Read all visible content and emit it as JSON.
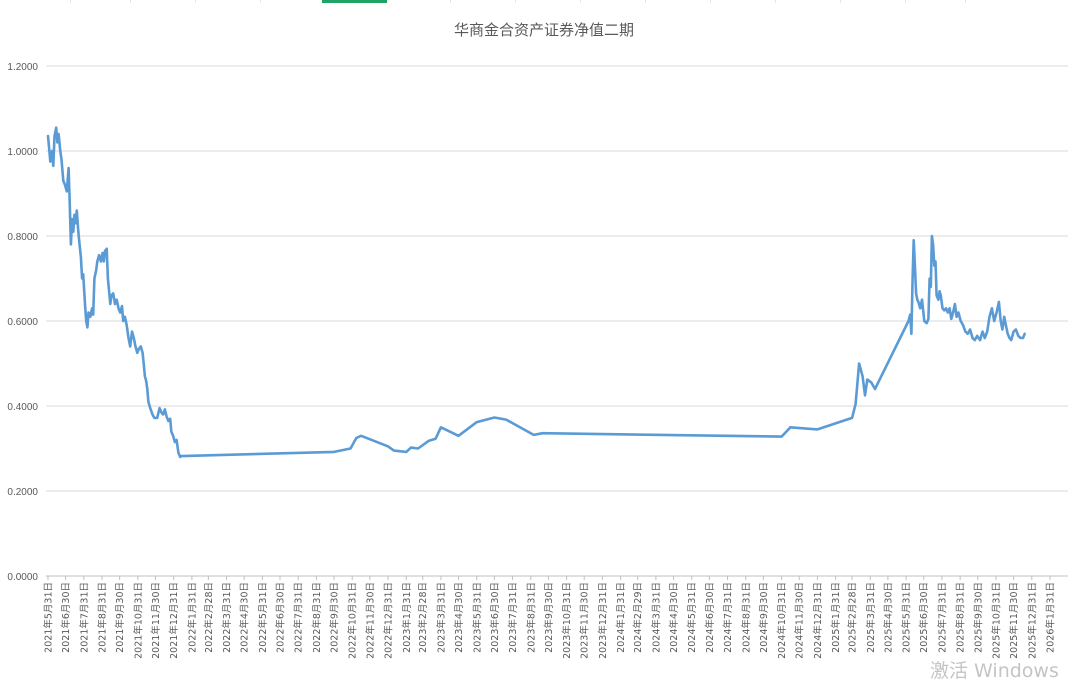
{
  "sheet_tabs": {
    "active_index": 4
  },
  "watermark": "激活 Windows",
  "colors": {
    "line": "#5b9bd5",
    "grid": "#d9d9d9",
    "title": "#595959",
    "tick": "#595959",
    "active_tab": "#21a366"
  },
  "chart_data": {
    "type": "line",
    "title": "华商金合资产证券净值二期",
    "xlabel": "",
    "ylabel": "",
    "ylim": [
      0,
      1.2
    ],
    "y_ticks": [
      "0.0000",
      "0.2000",
      "0.4000",
      "0.6000",
      "0.8000",
      "1.0000",
      "1.2000"
    ],
    "grid": "horizontal",
    "legend": "none",
    "x_ticks": [
      "2021年5月31日",
      "2021年6月30日",
      "2021年7月31日",
      "2021年8月31日",
      "2021年9月30日",
      "2021年10月31日",
      "2021年11月30日",
      "2021年12月31日",
      "2022年1月31日",
      "2022年2月28日",
      "2022年3月31日",
      "2022年4月30日",
      "2022年5月31日",
      "2022年6月30日",
      "2022年7月31日",
      "2022年8月31日",
      "2022年9月30日",
      "2022年10月31日",
      "2022年11月30日",
      "2022年12月31日",
      "2023年1月31日",
      "2023年2月28日",
      "2023年3月31日",
      "2023年4月30日",
      "2023年5月31日",
      "2023年6月30日",
      "2023年7月31日",
      "2023年8月31日",
      "2023年9月30日",
      "2023年10月31日",
      "2023年11月30日",
      "2023年12月31日",
      "2024年1月31日",
      "2024年2月29日",
      "2024年3月31日",
      "2024年4月30日",
      "2024年5月31日",
      "2024年6月30日",
      "2024年7月31日",
      "2024年8月31日",
      "2024年9月30日",
      "2024年10月31日",
      "2024年11月30日",
      "2024年12月31日",
      "2025年1月31日",
      "2025年2月28日",
      "2025年3月31日",
      "2025年4月30日",
      "2025年5月31日",
      "2025年6月30日",
      "2025年7月31日",
      "2025年8月31日",
      "2025年9月30日",
      "2025年10月31日",
      "2025年11月30日",
      "2025年12月31日",
      "2026年1月31日"
    ],
    "series": [
      {
        "values": [
          [
            "2021-05-31",
            1.035
          ],
          [
            "2021-06-02",
            1.005
          ],
          [
            "2021-06-04",
            0.975
          ],
          [
            "2021-06-07",
            1.0
          ],
          [
            "2021-06-09",
            0.965
          ],
          [
            "2021-06-11",
            1.035
          ],
          [
            "2021-06-14",
            1.055
          ],
          [
            "2021-06-16",
            1.02
          ],
          [
            "2021-06-18",
            1.04
          ],
          [
            "2021-06-21",
            1.0
          ],
          [
            "2021-06-23",
            0.98
          ],
          [
            "2021-06-26",
            0.93
          ],
          [
            "2021-06-29",
            0.92
          ],
          [
            "2021-07-02",
            0.905
          ],
          [
            "2021-07-05",
            0.96
          ],
          [
            "2021-07-07",
            0.88
          ],
          [
            "2021-07-09",
            0.78
          ],
          [
            "2021-07-11",
            0.84
          ],
          [
            "2021-07-13",
            0.81
          ],
          [
            "2021-07-15",
            0.85
          ],
          [
            "2021-07-17",
            0.83
          ],
          [
            "2021-07-19",
            0.86
          ],
          [
            "2021-07-21",
            0.82
          ],
          [
            "2021-07-23",
            0.79
          ],
          [
            "2021-07-26",
            0.75
          ],
          [
            "2021-07-28",
            0.7
          ],
          [
            "2021-07-30",
            0.71
          ],
          [
            "2021-08-02",
            0.64
          ],
          [
            "2021-08-04",
            0.6
          ],
          [
            "2021-08-06",
            0.585
          ],
          [
            "2021-08-08",
            0.62
          ],
          [
            "2021-08-11",
            0.61
          ],
          [
            "2021-08-14",
            0.63
          ],
          [
            "2021-08-16",
            0.615
          ],
          [
            "2021-08-18",
            0.7
          ],
          [
            "2021-08-21",
            0.72
          ],
          [
            "2021-08-23",
            0.74
          ],
          [
            "2021-08-26",
            0.755
          ],
          [
            "2021-08-29",
            0.74
          ],
          [
            "2021-09-01",
            0.76
          ],
          [
            "2021-09-03",
            0.74
          ],
          [
            "2021-09-05",
            0.765
          ],
          [
            "2021-09-08",
            0.77
          ],
          [
            "2021-09-10",
            0.7
          ],
          [
            "2021-09-12",
            0.67
          ],
          [
            "2021-09-14",
            0.64
          ],
          [
            "2021-09-16",
            0.66
          ],
          [
            "2021-09-19",
            0.665
          ],
          [
            "2021-09-22",
            0.64
          ],
          [
            "2021-09-25",
            0.65
          ],
          [
            "2021-09-28",
            0.63
          ],
          [
            "2021-10-01",
            0.62
          ],
          [
            "2021-10-04",
            0.635
          ],
          [
            "2021-10-06",
            0.6
          ],
          [
            "2021-10-09",
            0.61
          ],
          [
            "2021-10-12",
            0.59
          ],
          [
            "2021-10-15",
            0.56
          ],
          [
            "2021-10-18",
            0.54
          ],
          [
            "2021-10-21",
            0.575
          ],
          [
            "2021-10-24",
            0.56
          ],
          [
            "2021-10-27",
            0.54
          ],
          [
            "2021-10-30",
            0.525
          ],
          [
            "2021-11-02",
            0.535
          ],
          [
            "2021-11-05",
            0.54
          ],
          [
            "2021-11-08",
            0.525
          ],
          [
            "2021-11-10",
            0.5
          ],
          [
            "2021-11-12",
            0.47
          ],
          [
            "2021-11-14",
            0.46
          ],
          [
            "2021-11-16",
            0.44
          ],
          [
            "2021-11-18",
            0.41
          ],
          [
            "2021-11-21",
            0.395
          ],
          [
            "2021-11-25",
            0.38
          ],
          [
            "2021-11-28",
            0.372
          ],
          [
            "2021-12-03",
            0.372
          ],
          [
            "2021-12-07",
            0.395
          ],
          [
            "2021-12-10",
            0.385
          ],
          [
            "2021-12-13",
            0.38
          ],
          [
            "2021-12-16",
            0.392
          ],
          [
            "2021-12-19",
            0.375
          ],
          [
            "2021-12-22",
            0.365
          ],
          [
            "2021-12-25",
            0.37
          ],
          [
            "2021-12-27",
            0.34
          ],
          [
            "2021-12-30",
            0.33
          ],
          [
            "2022-01-02",
            0.315
          ],
          [
            "2022-01-05",
            0.32
          ],
          [
            "2022-01-08",
            0.29
          ],
          [
            "2022-01-11",
            0.28
          ],
          [
            "2022-01-13",
            0.282
          ],
          [
            "2022-09-30",
            0.292
          ],
          [
            "2022-10-28",
            0.3
          ],
          [
            "2022-11-07",
            0.325
          ],
          [
            "2022-11-15",
            0.33
          ],
          [
            "2022-12-31",
            0.305
          ],
          [
            "2023-01-10",
            0.295
          ],
          [
            "2023-01-31",
            0.292
          ],
          [
            "2023-02-08",
            0.302
          ],
          [
            "2023-02-20",
            0.3
          ],
          [
            "2023-03-10",
            0.318
          ],
          [
            "2023-03-22",
            0.323
          ],
          [
            "2023-03-31",
            0.35
          ],
          [
            "2023-04-30",
            0.33
          ],
          [
            "2023-05-31",
            0.362
          ],
          [
            "2023-06-30",
            0.373
          ],
          [
            "2023-07-20",
            0.368
          ],
          [
            "2023-09-05",
            0.332
          ],
          [
            "2023-09-20",
            0.336
          ],
          [
            "2024-10-31",
            0.328
          ],
          [
            "2024-11-15",
            0.35
          ],
          [
            "2024-12-31",
            0.345
          ],
          [
            "2025-02-28",
            0.372
          ],
          [
            "2025-03-06",
            0.405
          ],
          [
            "2025-03-12",
            0.5
          ],
          [
            "2025-03-18",
            0.47
          ],
          [
            "2025-03-22",
            0.425
          ],
          [
            "2025-03-26",
            0.462
          ],
          [
            "2025-04-02",
            0.455
          ],
          [
            "2025-04-08",
            0.44
          ],
          [
            "2025-06-04",
            0.6
          ],
          [
            "2025-06-07",
            0.615
          ],
          [
            "2025-06-09",
            0.57
          ],
          [
            "2025-06-11",
            0.7
          ],
          [
            "2025-06-13",
            0.79
          ],
          [
            "2025-06-15",
            0.73
          ],
          [
            "2025-06-17",
            0.665
          ],
          [
            "2025-06-19",
            0.65
          ],
          [
            "2025-06-21",
            0.645
          ],
          [
            "2025-06-24",
            0.63
          ],
          [
            "2025-06-27",
            0.65
          ],
          [
            "2025-07-01",
            0.6
          ],
          [
            "2025-07-05",
            0.595
          ],
          [
            "2025-07-08",
            0.605
          ],
          [
            "2025-07-10",
            0.7
          ],
          [
            "2025-07-12",
            0.68
          ],
          [
            "2025-07-14",
            0.8
          ],
          [
            "2025-07-16",
            0.78
          ],
          [
            "2025-07-18",
            0.73
          ],
          [
            "2025-07-20",
            0.74
          ],
          [
            "2025-07-22",
            0.66
          ],
          [
            "2025-07-25",
            0.65
          ],
          [
            "2025-07-27",
            0.67
          ],
          [
            "2025-07-29",
            0.66
          ],
          [
            "2025-08-01",
            0.63
          ],
          [
            "2025-08-04",
            0.625
          ],
          [
            "2025-08-07",
            0.63
          ],
          [
            "2025-08-10",
            0.62
          ],
          [
            "2025-08-13",
            0.63
          ],
          [
            "2025-08-16",
            0.605
          ],
          [
            "2025-08-19",
            0.62
          ],
          [
            "2025-08-22",
            0.64
          ],
          [
            "2025-08-25",
            0.61
          ],
          [
            "2025-08-28",
            0.62
          ],
          [
            "2025-09-01",
            0.6
          ],
          [
            "2025-09-05",
            0.59
          ],
          [
            "2025-09-09",
            0.575
          ],
          [
            "2025-09-13",
            0.57
          ],
          [
            "2025-09-17",
            0.58
          ],
          [
            "2025-09-21",
            0.56
          ],
          [
            "2025-09-25",
            0.555
          ],
          [
            "2025-09-29",
            0.565
          ],
          [
            "2025-10-04",
            0.555
          ],
          [
            "2025-10-08",
            0.575
          ],
          [
            "2025-10-12",
            0.56
          ],
          [
            "2025-10-16",
            0.575
          ],
          [
            "2025-10-20",
            0.61
          ],
          [
            "2025-10-24",
            0.63
          ],
          [
            "2025-10-28",
            0.6
          ],
          [
            "2025-11-01",
            0.62
          ],
          [
            "2025-11-05",
            0.645
          ],
          [
            "2025-11-08",
            0.6
          ],
          [
            "2025-11-11",
            0.58
          ],
          [
            "2025-11-14",
            0.61
          ],
          [
            "2025-11-17",
            0.59
          ],
          [
            "2025-11-20",
            0.57
          ],
          [
            "2025-11-23",
            0.56
          ],
          [
            "2025-11-26",
            0.555
          ],
          [
            "2025-11-30",
            0.575
          ],
          [
            "2025-12-04",
            0.58
          ],
          [
            "2025-12-08",
            0.565
          ],
          [
            "2025-12-12",
            0.56
          ],
          [
            "2025-12-16",
            0.56
          ],
          [
            "2025-12-19",
            0.57
          ]
        ]
      }
    ]
  }
}
